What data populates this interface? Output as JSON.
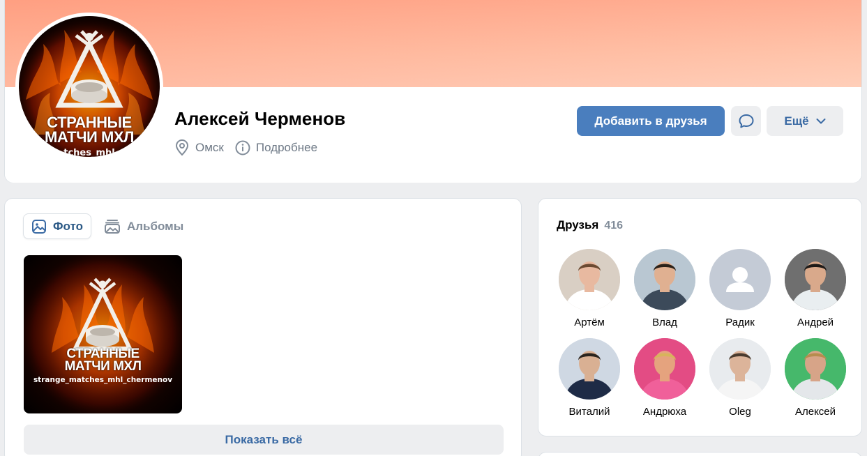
{
  "profile": {
    "name": "Алексей Черменов",
    "city": "Омск",
    "details_link": "Подробнее",
    "avatar_logo": {
      "line1": "СТРАННЫЕ",
      "line2": "МАТЧИ МХЛ",
      "handle": "tches_mhl"
    },
    "cover_color": "#ffb296"
  },
  "actions": {
    "add_friend_label": "Добавить в друзья",
    "more_label": "Ещё",
    "accent": "#4a7ebe"
  },
  "photos": {
    "tabs": [
      {
        "label": "Фото",
        "icon": "photo-icon",
        "active": true
      },
      {
        "label": "Альбомы",
        "icon": "albums-icon",
        "active": false
      }
    ],
    "thumb_logo": {
      "line1": "СТРАННЫЕ",
      "line2": "МАТЧИ МХЛ",
      "handle": "strange_matches_mhl_chermenov"
    },
    "show_all_label": "Показать всё"
  },
  "friends": {
    "title": "Друзья",
    "count": "416",
    "items": [
      {
        "name": "Артём",
        "bg": "#d9cfc4",
        "shirt": "#ffffff",
        "skin": "#e8b9a0",
        "hair": "#6b4a32"
      },
      {
        "name": "Влад",
        "bg": "#b9c7d2",
        "shirt": "#3c4a5a",
        "skin": "#e0b091",
        "hair": "#2a2119"
      },
      {
        "name": "Радик",
        "placeholder": true,
        "bg": "#c4cbd6"
      },
      {
        "name": "Андрей",
        "bg": "#6f6f6f",
        "shirt": "#e9eef0",
        "skin": "#d9a98b",
        "hair": "#1e1a17"
      },
      {
        "name": "Виталий",
        "bg": "#cfd8e3",
        "shirt": "#1e2b46",
        "skin": "#d9b093",
        "hair": "#2a241e"
      },
      {
        "name": "Андрюха",
        "bg": "#e34c84",
        "shirt": "#f0609a",
        "skin": "#e5a37e",
        "hair": "#d7b45b"
      },
      {
        "name": "Oleg",
        "bg": "#e8ebee",
        "shirt": "#f5f5f5",
        "skin": "#dcb49a",
        "hair": "#4a3b2e"
      },
      {
        "name": "Алексей",
        "bg": "#46b86b",
        "shirt": "#e4e7ea",
        "skin": "#d7a488",
        "hair": "#b78c4e"
      }
    ]
  }
}
